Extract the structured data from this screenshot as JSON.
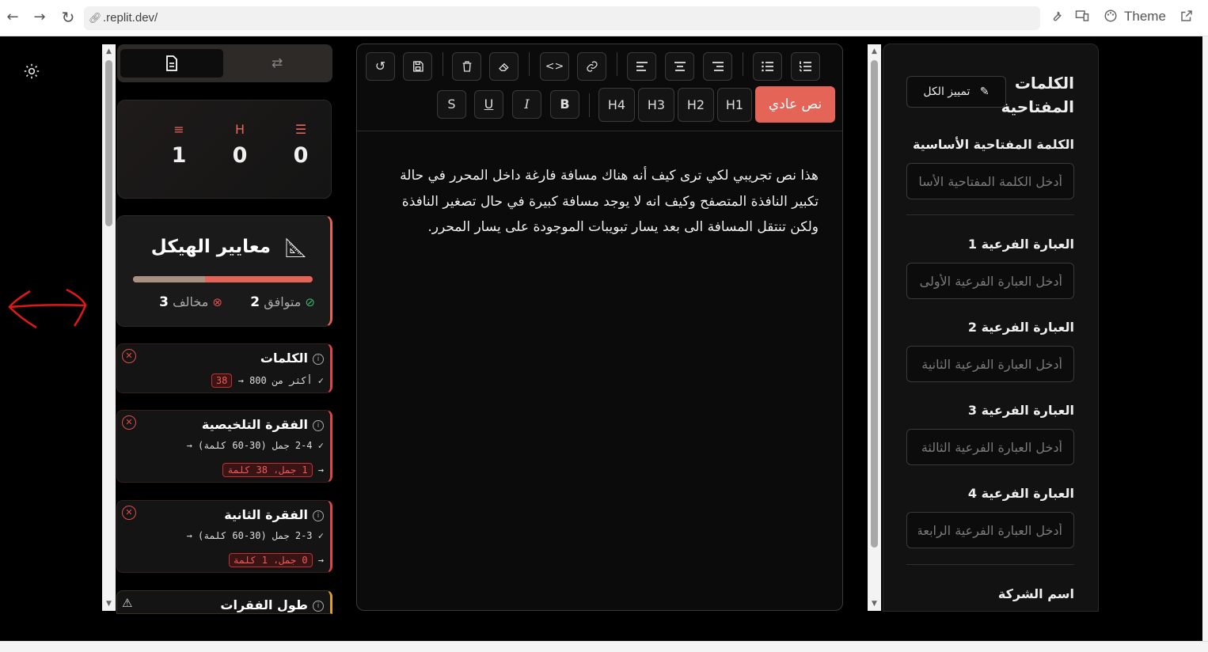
{
  "browser": {
    "url": ".replit.dev/",
    "theme_label": "Theme"
  },
  "left_panel": {
    "tabs": [
      {
        "icon": "document-icon",
        "active": true
      },
      {
        "icon": "swap-icon",
        "active": false
      }
    ],
    "stats": [
      {
        "icon": "list-icon",
        "value": "0"
      },
      {
        "icon": "heading-icon",
        "label": "H",
        "value": "0"
      },
      {
        "icon": "paragraph-icon",
        "value": "1"
      }
    ],
    "structure": {
      "title": "معايير الهيكل",
      "progress_fraction": 0.4,
      "compliant_label": "متوافق",
      "compliant_count": "2",
      "violating_label": "مخالف",
      "violating_count": "3"
    },
    "rules": [
      {
        "title": "الكلمات",
        "line1": "✓ أكثر من 800 → ",
        "badge1": "38"
      },
      {
        "title": "الفقرة التلخيصية",
        "line1": "✓ 2-4 جمل (30-60 كلمة) →",
        "line2": "→ ",
        "badge2": "1 جمل، 38 كلمة"
      },
      {
        "title": "الفقرة الثانية",
        "line1": "✓ 2-3 جمل (30-60 كلمة) →",
        "line2": "→ ",
        "badge2": "0 جمل، 1 كلمة"
      },
      {
        "title": "طول الفقرات"
      }
    ]
  },
  "editor": {
    "toolbar": {
      "row2": [
        "نص عادي",
        "H1",
        "H2",
        "H3",
        "H4"
      ],
      "format": [
        "B",
        "I",
        "U",
        "S"
      ]
    },
    "content": "هذا نص تجريبي لكي ترى كيف أنه هناك مسافة فارغة داخل المحرر في حالة تكبير النافذة المتصفح وكيف انه لا يوجد مسافة كبيرة في حال تصغير النافذة ولكن تنتقل المسافة الى بعد يسار تبويبات الموجودة على يسار المحرر."
  },
  "right_panel": {
    "title": "الكلمات المفتاحية",
    "highlight_all": "تمييز الكل",
    "fields": [
      {
        "label": "الكلمة المفتاحية الأساسية",
        "placeholder": "أدخل الكلمة المفتاحية الأساسية"
      },
      {
        "label": "العبارة الفرعية 1",
        "placeholder": "أدخل العبارة الفرعية الأولى"
      },
      {
        "label": "العبارة الفرعية 2",
        "placeholder": "أدخل العبارة الفرعية الثانية"
      },
      {
        "label": "العبارة الفرعية 3",
        "placeholder": "أدخل العبارة الفرعية الثالثة"
      },
      {
        "label": "العبارة الفرعية 4",
        "placeholder": "أدخل العبارة الفرعية الرابعة"
      },
      {
        "label": "اسم الشركة"
      }
    ]
  },
  "colors": {
    "accent": "#e56458",
    "ok": "#39b86a",
    "bad": "#e04c4c",
    "warning": "#e0a020"
  }
}
